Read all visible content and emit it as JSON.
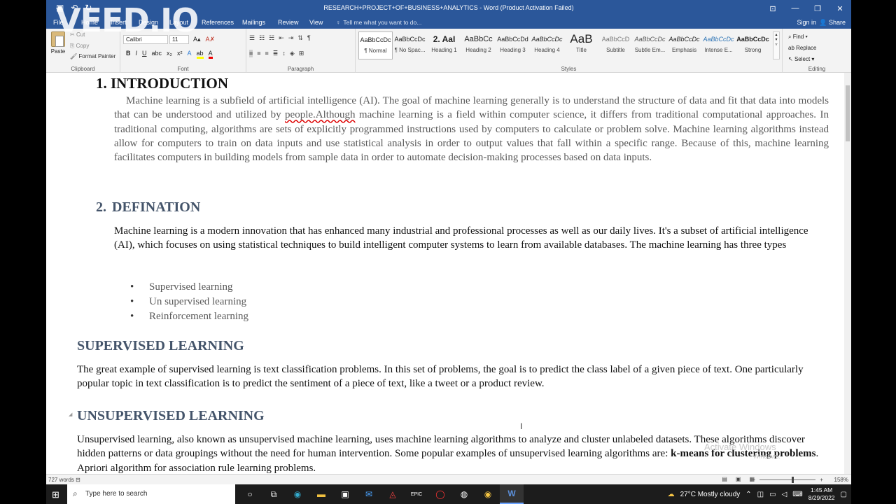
{
  "window": {
    "title": "RESEARCH+PROJECT+OF+BUSINESS+ANALYTICS - Word (Product Activation Failed)",
    "watermark": "VEED.IO"
  },
  "tabs": {
    "items": [
      "File",
      "Home",
      "Insert",
      "Design",
      "Layout",
      "References",
      "Mailings",
      "Review",
      "View"
    ],
    "tell_me": "Tell me what you want to do...",
    "sign_in": "Sign in",
    "share": "Share"
  },
  "ribbon": {
    "clipboard": {
      "paste": "Paste",
      "cut": "Cut",
      "copy": "Copy",
      "format_painter": "Format Painter",
      "label": "Clipboard"
    },
    "font": {
      "name": "Calibri",
      "size": "11",
      "label": "Font",
      "bold": "B",
      "italic": "I",
      "underline": "U"
    },
    "paragraph": {
      "label": "Paragraph"
    },
    "styles": {
      "label": "Styles",
      "items": [
        {
          "sample": "AaBbCcDc",
          "name": "¶ Normal"
        },
        {
          "sample": "AaBbCcDc",
          "name": "¶ No Spac..."
        },
        {
          "sample": "2. AaI",
          "name": "Heading 1"
        },
        {
          "sample": "AaBbCc",
          "name": "Heading 2"
        },
        {
          "sample": "AaBbCcDd",
          "name": "Heading 3"
        },
        {
          "sample": "AaBbCcDc",
          "name": "Heading 4"
        },
        {
          "sample": "AaB",
          "name": "Title"
        },
        {
          "sample": "AaBbCcD",
          "name": "Subtitle"
        },
        {
          "sample": "AaBbCcDc",
          "name": "Subtle Em..."
        },
        {
          "sample": "AaBbCcDc",
          "name": "Emphasis"
        },
        {
          "sample": "AaBbCcDc",
          "name": "Intense E..."
        },
        {
          "sample": "AaBbCcDc",
          "name": "Strong"
        }
      ]
    },
    "editing": {
      "label": "Editing",
      "find": "Find",
      "replace": "Replace",
      "select": "Select"
    }
  },
  "document": {
    "h_intro": "1. INTRODUCTION",
    "p_intro_1": "Machine learning is a subfield of artificial intelligence (AI). The goal of machine learning generally is to understand the structure of data and fit that data into models that can be understood and utilized by ",
    "p_intro_spell": "people.Although",
    "p_intro_2": " machine learning is a field within computer science, it differs from traditional computational approaches. In traditional computing, algorithms are sets of explicitly programmed instructions used by computers to calculate or problem solve. Machine learning algorithms instead allow for computers to train on data inputs and use statistical analysis in order to output values that fall within a specific range. Because of this, machine learning facilitates computers in building models from sample data in order to automate decision-making processes based on data inputs.",
    "h_def": "2.",
    "h_def_text": "DEFINATION",
    "p_def": "Machine learning is a modern innovation that has enhanced many industrial and professional processes as well as our daily lives. It's a subset of artificial intelligence (AI), which focuses on using statistical techniques to build intelligent computer systems to learn from available databases. The machine learning has three types",
    "bullets": [
      "Supervised learning",
      "Un supervised learning",
      "Reinforcement learning"
    ],
    "h_sup": "SUPERVISED LEARNING",
    "p_sup": "The great example of supervised learning is text classification problems. In this set of problems, the goal is to predict the class label of a given piece of text. One particularly popular topic in text classification is to predict the sentiment of a piece of text, like a tweet or a product review.",
    "h_unsup": "UNSUPERVISED LEARNING",
    "p_unsup_1": "Unsupervised learning, also known as unsupervised machine learning, uses machine learning algorithms to analyze and cluster unlabeled datasets. These algorithms discover hidden patterns or data groupings without the need for human intervention. Some popular examples of unsupervised learning algorithms are: ",
    "p_unsup_bold": "k-means for clustering problems",
    "p_unsup_2": ". Apriori algorithm for association rule learning problems.",
    "activate_title": "Activate Windows",
    "activate_sub": "Windows."
  },
  "status": {
    "words": "727 words",
    "zoom": "158%"
  },
  "taskbar": {
    "search_placeholder": "Type here to search",
    "weather": "27°C  Mostly cloudy",
    "time": "1:45 AM",
    "date": "8/29/2022"
  }
}
